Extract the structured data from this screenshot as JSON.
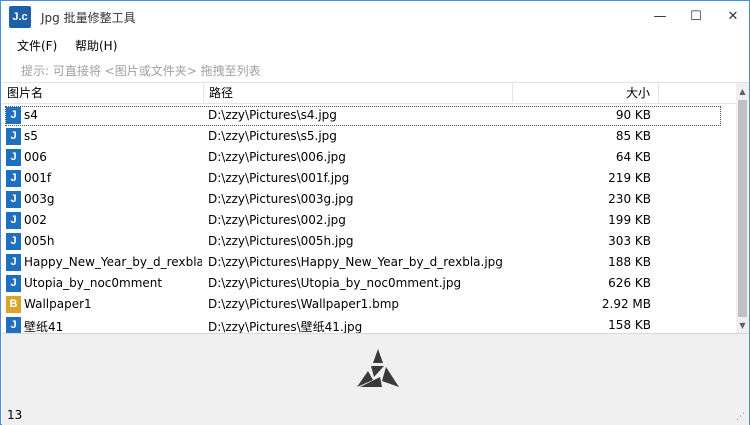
{
  "app": {
    "icon_text": "J.c",
    "title": "Jpg 批量修整工具"
  },
  "window_controls": {
    "minimize": "—",
    "maximize": "☐",
    "close": "✕"
  },
  "menu": {
    "file": "文件(F)",
    "help": "帮助(H)"
  },
  "hint": "提示: 可直接将 <图片或文件夹> 拖拽至列表",
  "columns": {
    "name": "图片名",
    "path": "路径",
    "size": "大小"
  },
  "rows": [
    {
      "icon": "J",
      "name": "s4",
      "path": "D:\\zzy\\Pictures\\s4.jpg",
      "size": "90 KB"
    },
    {
      "icon": "J",
      "name": "s5",
      "path": "D:\\zzy\\Pictures\\s5.jpg",
      "size": "85 KB"
    },
    {
      "icon": "J",
      "name": "006",
      "path": "D:\\zzy\\Pictures\\006.jpg",
      "size": "64 KB"
    },
    {
      "icon": "J",
      "name": "001f",
      "path": "D:\\zzy\\Pictures\\001f.jpg",
      "size": "219 KB"
    },
    {
      "icon": "J",
      "name": "003g",
      "path": "D:\\zzy\\Pictures\\003g.jpg",
      "size": "230 KB"
    },
    {
      "icon": "J",
      "name": "002",
      "path": "D:\\zzy\\Pictures\\002.jpg",
      "size": "199 KB"
    },
    {
      "icon": "J",
      "name": "005h",
      "path": "D:\\zzy\\Pictures\\005h.jpg",
      "size": "303 KB"
    },
    {
      "icon": "J",
      "name": "Happy_New_Year_by_d_rexbla",
      "path": "D:\\zzy\\Pictures\\Happy_New_Year_by_d_rexbla.jpg",
      "size": "188 KB"
    },
    {
      "icon": "J",
      "name": "Utopia_by_noc0mment",
      "path": "D:\\zzy\\Pictures\\Utopia_by_noc0mment.jpg",
      "size": "626 KB"
    },
    {
      "icon": "B",
      "name": "Wallpaper1",
      "path": "D:\\zzy\\Pictures\\Wallpaper1.bmp",
      "size": "2.92 MB"
    },
    {
      "icon": "J",
      "name": "壁纸41",
      "path": "D:\\zzy\\Pictures\\壁纸41.jpg",
      "size": "158 KB"
    }
  ],
  "status": {
    "count": "13"
  },
  "colors": {
    "jpg_icon": "#1f6fbf",
    "bmp_icon": "#d8a429",
    "window_border": "#4a8fd6"
  }
}
